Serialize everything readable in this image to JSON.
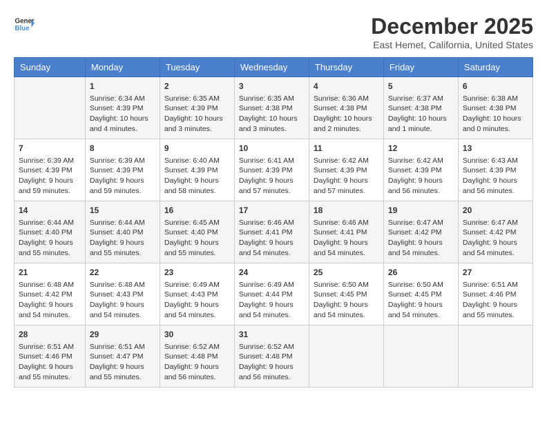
{
  "header": {
    "logo_line1": "General",
    "logo_line2": "Blue",
    "month_title": "December 2025",
    "location": "East Hemet, California, United States"
  },
  "days_of_week": [
    "Sunday",
    "Monday",
    "Tuesday",
    "Wednesday",
    "Thursday",
    "Friday",
    "Saturday"
  ],
  "weeks": [
    [
      {
        "day": "",
        "content": ""
      },
      {
        "day": "1",
        "content": "Sunrise: 6:34 AM\nSunset: 4:39 PM\nDaylight: 10 hours\nand 4 minutes."
      },
      {
        "day": "2",
        "content": "Sunrise: 6:35 AM\nSunset: 4:39 PM\nDaylight: 10 hours\nand 3 minutes."
      },
      {
        "day": "3",
        "content": "Sunrise: 6:35 AM\nSunset: 4:38 PM\nDaylight: 10 hours\nand 3 minutes."
      },
      {
        "day": "4",
        "content": "Sunrise: 6:36 AM\nSunset: 4:38 PM\nDaylight: 10 hours\nand 2 minutes."
      },
      {
        "day": "5",
        "content": "Sunrise: 6:37 AM\nSunset: 4:38 PM\nDaylight: 10 hours\nand 1 minute."
      },
      {
        "day": "6",
        "content": "Sunrise: 6:38 AM\nSunset: 4:38 PM\nDaylight: 10 hours\nand 0 minutes."
      }
    ],
    [
      {
        "day": "7",
        "content": "Sunrise: 6:39 AM\nSunset: 4:39 PM\nDaylight: 9 hours\nand 59 minutes."
      },
      {
        "day": "8",
        "content": "Sunrise: 6:39 AM\nSunset: 4:39 PM\nDaylight: 9 hours\nand 59 minutes."
      },
      {
        "day": "9",
        "content": "Sunrise: 6:40 AM\nSunset: 4:39 PM\nDaylight: 9 hours\nand 58 minutes."
      },
      {
        "day": "10",
        "content": "Sunrise: 6:41 AM\nSunset: 4:39 PM\nDaylight: 9 hours\nand 57 minutes."
      },
      {
        "day": "11",
        "content": "Sunrise: 6:42 AM\nSunset: 4:39 PM\nDaylight: 9 hours\nand 57 minutes."
      },
      {
        "day": "12",
        "content": "Sunrise: 6:42 AM\nSunset: 4:39 PM\nDaylight: 9 hours\nand 56 minutes."
      },
      {
        "day": "13",
        "content": "Sunrise: 6:43 AM\nSunset: 4:39 PM\nDaylight: 9 hours\nand 56 minutes."
      }
    ],
    [
      {
        "day": "14",
        "content": "Sunrise: 6:44 AM\nSunset: 4:40 PM\nDaylight: 9 hours\nand 55 minutes."
      },
      {
        "day": "15",
        "content": "Sunrise: 6:44 AM\nSunset: 4:40 PM\nDaylight: 9 hours\nand 55 minutes."
      },
      {
        "day": "16",
        "content": "Sunrise: 6:45 AM\nSunset: 4:40 PM\nDaylight: 9 hours\nand 55 minutes."
      },
      {
        "day": "17",
        "content": "Sunrise: 6:46 AM\nSunset: 4:41 PM\nDaylight: 9 hours\nand 54 minutes."
      },
      {
        "day": "18",
        "content": "Sunrise: 6:46 AM\nSunset: 4:41 PM\nDaylight: 9 hours\nand 54 minutes."
      },
      {
        "day": "19",
        "content": "Sunrise: 6:47 AM\nSunset: 4:42 PM\nDaylight: 9 hours\nand 54 minutes."
      },
      {
        "day": "20",
        "content": "Sunrise: 6:47 AM\nSunset: 4:42 PM\nDaylight: 9 hours\nand 54 minutes."
      }
    ],
    [
      {
        "day": "21",
        "content": "Sunrise: 6:48 AM\nSunset: 4:42 PM\nDaylight: 9 hours\nand 54 minutes."
      },
      {
        "day": "22",
        "content": "Sunrise: 6:48 AM\nSunset: 4:43 PM\nDaylight: 9 hours\nand 54 minutes."
      },
      {
        "day": "23",
        "content": "Sunrise: 6:49 AM\nSunset: 4:43 PM\nDaylight: 9 hours\nand 54 minutes."
      },
      {
        "day": "24",
        "content": "Sunrise: 6:49 AM\nSunset: 4:44 PM\nDaylight: 9 hours\nand 54 minutes."
      },
      {
        "day": "25",
        "content": "Sunrise: 6:50 AM\nSunset: 4:45 PM\nDaylight: 9 hours\nand 54 minutes."
      },
      {
        "day": "26",
        "content": "Sunrise: 6:50 AM\nSunset: 4:45 PM\nDaylight: 9 hours\nand 54 minutes."
      },
      {
        "day": "27",
        "content": "Sunrise: 6:51 AM\nSunset: 4:46 PM\nDaylight: 9 hours\nand 55 minutes."
      }
    ],
    [
      {
        "day": "28",
        "content": "Sunrise: 6:51 AM\nSunset: 4:46 PM\nDaylight: 9 hours\nand 55 minutes."
      },
      {
        "day": "29",
        "content": "Sunrise: 6:51 AM\nSunset: 4:47 PM\nDaylight: 9 hours\nand 55 minutes."
      },
      {
        "day": "30",
        "content": "Sunrise: 6:52 AM\nSunset: 4:48 PM\nDaylight: 9 hours\nand 56 minutes."
      },
      {
        "day": "31",
        "content": "Sunrise: 6:52 AM\nSunset: 4:48 PM\nDaylight: 9 hours\nand 56 minutes."
      },
      {
        "day": "",
        "content": ""
      },
      {
        "day": "",
        "content": ""
      },
      {
        "day": "",
        "content": ""
      }
    ]
  ]
}
